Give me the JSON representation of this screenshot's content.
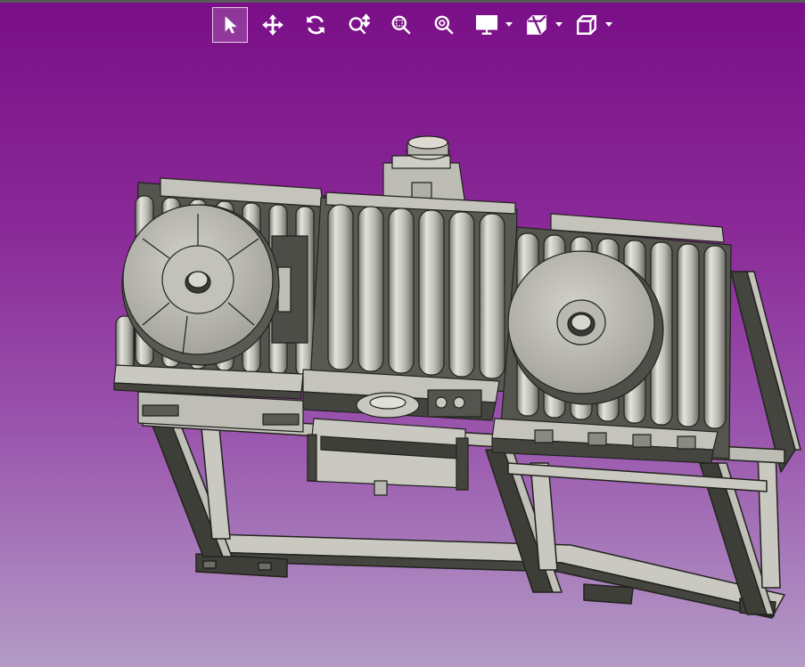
{
  "toolbar": {
    "buttons": [
      {
        "name": "select-icon",
        "active": true
      },
      {
        "name": "pan-icon"
      },
      {
        "name": "rotate-icon"
      },
      {
        "name": "zoom-icon"
      },
      {
        "name": "zoom-window-icon"
      },
      {
        "name": "zoom-fit-icon"
      },
      {
        "name": "display-mode-icon",
        "dropdown": true
      },
      {
        "name": "section-view-icon",
        "dropdown": true
      },
      {
        "name": "standard-view-icon",
        "dropdown": true
      }
    ]
  },
  "viewport": {
    "background": {
      "top": "#7a0f87",
      "bottom": "#b39bc6"
    },
    "model": {
      "description_icon": "roller-conveyor-assembly",
      "colors": {
        "metal": "#c4c4bc",
        "dark": "#4a4a44",
        "edge": "#2b2b28"
      }
    }
  }
}
